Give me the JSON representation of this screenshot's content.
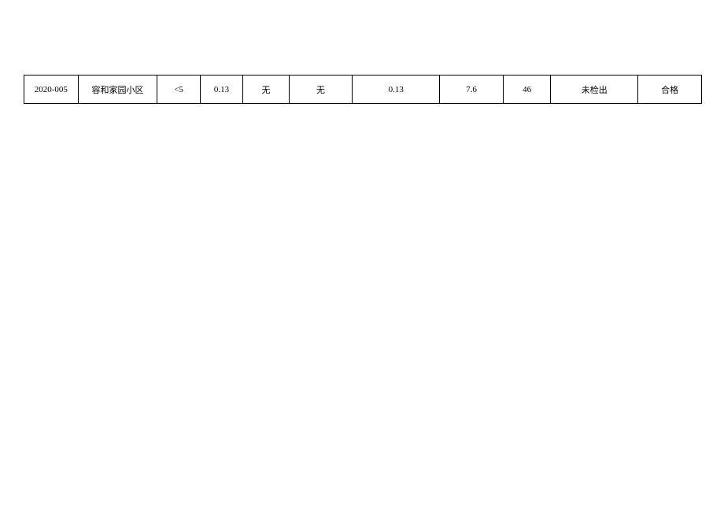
{
  "table": {
    "rows": [
      {
        "id": "2020-005",
        "name": "容和家园小区",
        "col2": "<5",
        "col3": "0.13",
        "col4": "无",
        "col5": "无",
        "col6": "0.13",
        "col7": "7.6",
        "col8": "46",
        "col9": "未检出",
        "col10": "合格"
      }
    ]
  }
}
